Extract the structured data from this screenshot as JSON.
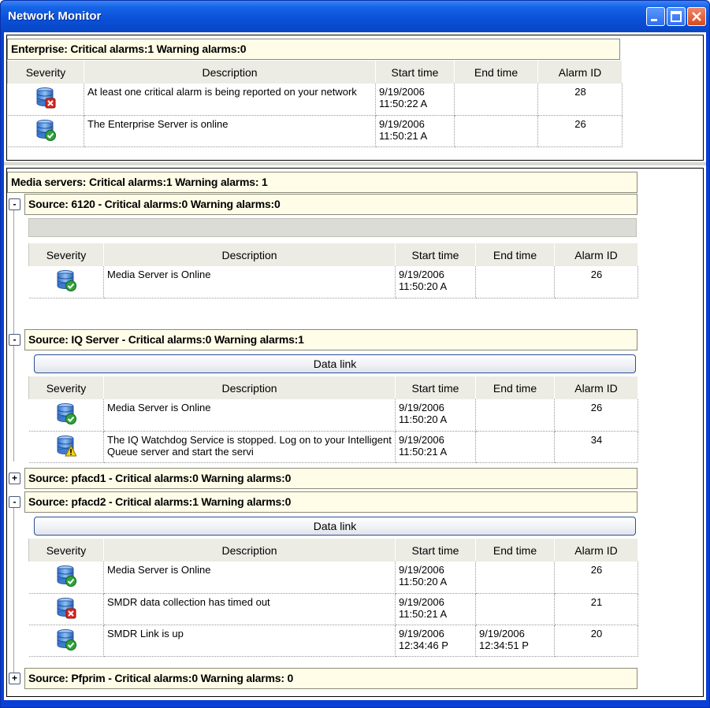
{
  "window": {
    "title": "Network Monitor"
  },
  "columns": [
    "Severity",
    "Description",
    "Start time",
    "End time",
    "Alarm ID"
  ],
  "enterprise": {
    "header": "Enterprise: Critical alarms:1   Warning alarms:0",
    "rows": [
      {
        "severity": "critical",
        "description": "At least one critical alarm is being reported on your network",
        "start_date": "9/19/2006",
        "start_time": "11:50:22 A",
        "end_date": "",
        "end_time": "",
        "alarm_id": "28"
      },
      {
        "severity": "ok",
        "description": "The Enterprise Server is online",
        "start_date": "9/19/2006",
        "start_time": "11:50:21 A",
        "end_date": "",
        "end_time": "",
        "alarm_id": "26"
      }
    ]
  },
  "media": {
    "header": "Media servers: Critical alarms:1   Warning alarms: 1",
    "data_link_label": "Data link",
    "sources": [
      {
        "toggle": "-",
        "header": "Source: 6120 - Critical alarms:0   Warning alarms:0",
        "rows": [
          {
            "severity": "ok",
            "description": "Media Server is Online",
            "start_date": "9/19/2006",
            "start_time": "11:50:20 A",
            "end_date": "",
            "end_time": "",
            "alarm_id": "26"
          }
        ]
      },
      {
        "toggle": "-",
        "header": "Source: IQ  Server - Critical alarms:0   Warning alarms:1",
        "rows": [
          {
            "severity": "ok",
            "description": "Media Server is Online",
            "start_date": "9/19/2006",
            "start_time": "11:50:20 A",
            "end_date": "",
            "end_time": "",
            "alarm_id": "26"
          },
          {
            "severity": "warning",
            "description": "The IQ Watchdog Service is stopped. Log on to your Intelligent Queue server and start the servi",
            "start_date": "9/19/2006",
            "start_time": "11:50:21 A",
            "end_date": "",
            "end_time": "",
            "alarm_id": "34"
          }
        ]
      },
      {
        "toggle": "+",
        "header": "Source: pfacd1 - Critical alarms:0   Warning alarms:0"
      },
      {
        "toggle": "-",
        "header": "Source: pfacd2 - Critical alarms:1   Warning alarms:0",
        "rows": [
          {
            "severity": "ok",
            "description": "Media Server is Online",
            "start_date": "9/19/2006",
            "start_time": "11:50:20 A",
            "end_date": "",
            "end_time": "",
            "alarm_id": "26"
          },
          {
            "severity": "critical",
            "description": "SMDR data collection has timed out",
            "start_date": "9/19/2006",
            "start_time": "11:50:21 A",
            "end_date": "",
            "end_time": "",
            "alarm_id": "21"
          },
          {
            "severity": "ok",
            "description": "SMDR Link is up",
            "start_date": "9/19/2006",
            "start_time": "12:34:46 P",
            "end_date": "9/19/2006",
            "end_time": "12:34:51 P",
            "alarm_id": "20"
          }
        ]
      },
      {
        "toggle": "+",
        "header": "Source: Pfprim - Critical alarms:0   Warning alarms: 0"
      }
    ]
  },
  "colors": {
    "titlebar": "#0a50d8",
    "band_background": "#fffde8",
    "critical_badge": "#d8261e",
    "ok_badge": "#2fa33a",
    "warning_badge": "#f2d21a"
  }
}
